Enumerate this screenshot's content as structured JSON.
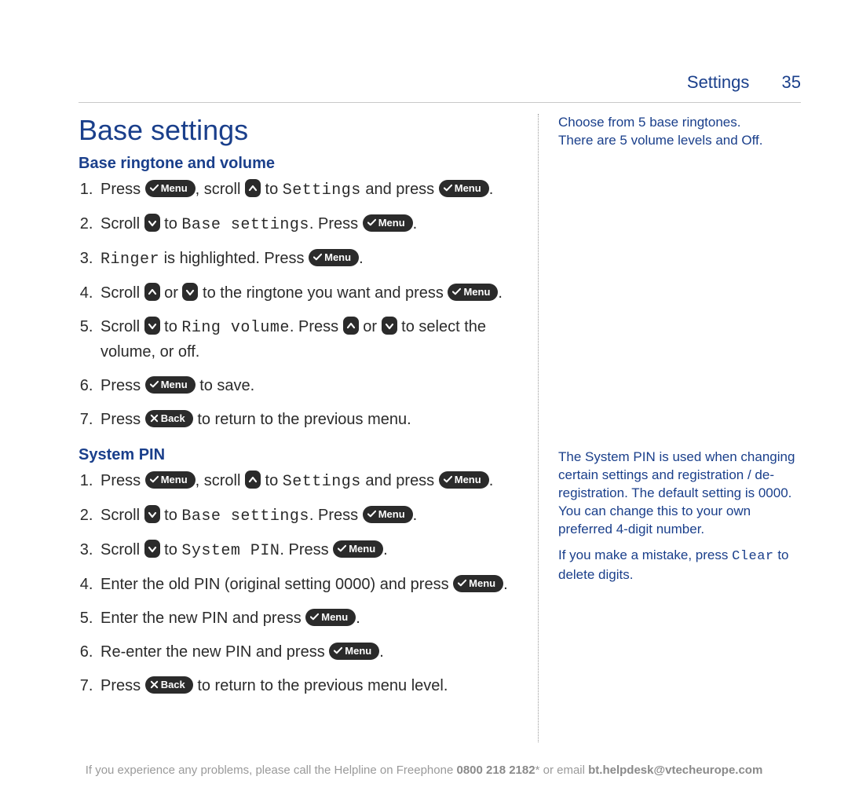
{
  "header": {
    "section": "Settings",
    "page_number": "35"
  },
  "title": "Base settings",
  "section1_heading": "Base ringtone and volume",
  "section2_heading": "System PIN",
  "btn": {
    "menu": "Menu",
    "back": "Back"
  },
  "s1": {
    "step1_a": "Press ",
    "step1_b": ", scroll ",
    "step1_c": " to ",
    "step1_settings": "Settings",
    "step1_d": " and press ",
    "step1_e": ".",
    "step2_a": "Scroll ",
    "step2_b": " to ",
    "step2_base": "Base settings",
    "step2_c": ". Press ",
    "step2_d": ".",
    "step3_a": "",
    "step3_ringer": "Ringer",
    "step3_b": " is highlighted. Press ",
    "step3_c": ".",
    "step4_a": "Scroll ",
    "step4_b": " or ",
    "step4_c": " to the ringtone you want and press ",
    "step4_d": ".",
    "step5_a": "Scroll ",
    "step5_b": " to ",
    "step5_ringvol": "Ring volume",
    "step5_c": ". Press ",
    "step5_d": " or ",
    "step5_e": " to select the volume, or off.",
    "step6_a": "Press ",
    "step6_b": " to save.",
    "step7_a": "Press ",
    "step7_b": " to return to the previous menu."
  },
  "s2": {
    "step1_a": "Press ",
    "step1_b": ", scroll ",
    "step1_c": " to ",
    "step1_settings": "Settings",
    "step1_d": " and press ",
    "step1_e": ".",
    "step2_a": "Scroll ",
    "step2_b": " to ",
    "step2_base": "Base settings",
    "step2_c": ". Press ",
    "step2_d": ".",
    "step3_a": "Scroll ",
    "step3_b": " to ",
    "step3_syspin": "System PIN",
    "step3_c": ". Press ",
    "step3_d": ".",
    "step4_a": "Enter the old PIN (original setting 0000) and press ",
    "step4_b": ".",
    "step5_a": "Enter the new PIN and press ",
    "step5_b": ".",
    "step6_a": "Re-enter the new PIN and press ",
    "step6_b": ".",
    "step7_a": "Press ",
    "step7_b": " to return to the previous menu level."
  },
  "side": {
    "note1_l1": "Choose from 5 base ringtones.",
    "note1_l2": "There are 5 volume levels and Off.",
    "note2_p1": "The System PIN is used when changing certain settings and registration / de-registration. The default setting is 0000. You can change this to your own preferred 4-digit number.",
    "note2_p2a": "If you make a mistake, press ",
    "note2_clear": "Clear",
    "note2_p2b": " to delete digits."
  },
  "footer": {
    "a": "If you experience any problems, please call the Helpline on Freephone ",
    "phone": "0800 218 2182",
    "b": "* or email ",
    "email": "bt.helpdesk@vtecheurope.com"
  }
}
